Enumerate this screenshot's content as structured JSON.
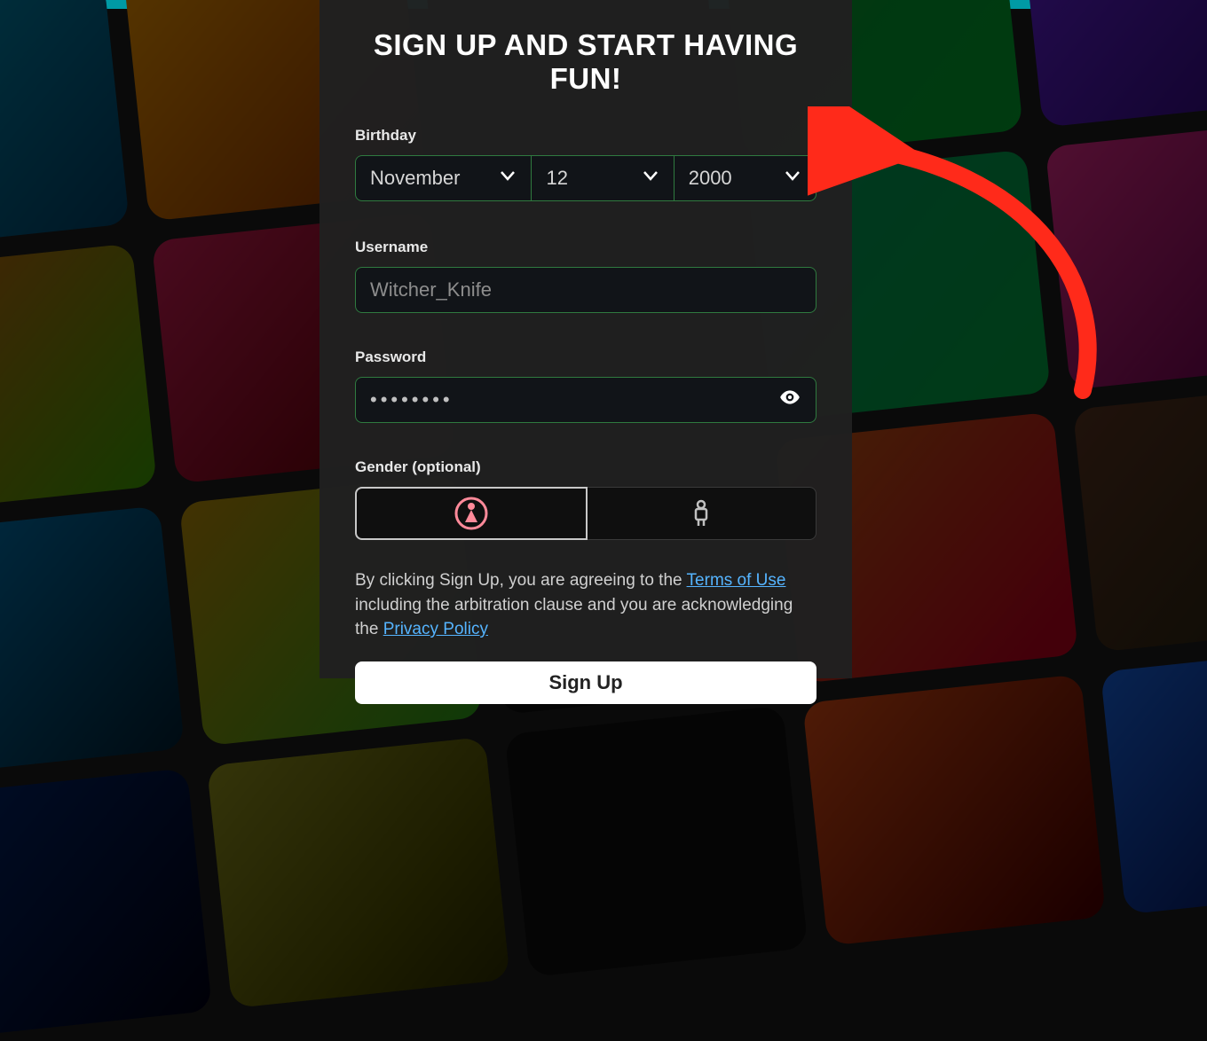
{
  "heading": "SIGN UP AND START HAVING FUN!",
  "birthday": {
    "label": "Birthday",
    "month": "November",
    "day": "12",
    "year": "2000"
  },
  "username": {
    "label": "Username",
    "value": "Witcher_Knife"
  },
  "password": {
    "label": "Password",
    "masked": "••••••••"
  },
  "gender": {
    "label": "Gender (optional)",
    "selected": "female"
  },
  "legal": {
    "prefix": "By clicking Sign Up, you are agreeing to the ",
    "terms_link": "Terms of Use",
    "middle": " including the arbitration clause and you are acknowledging the ",
    "privacy_link": "Privacy Policy"
  },
  "signup_button": "Sign Up"
}
